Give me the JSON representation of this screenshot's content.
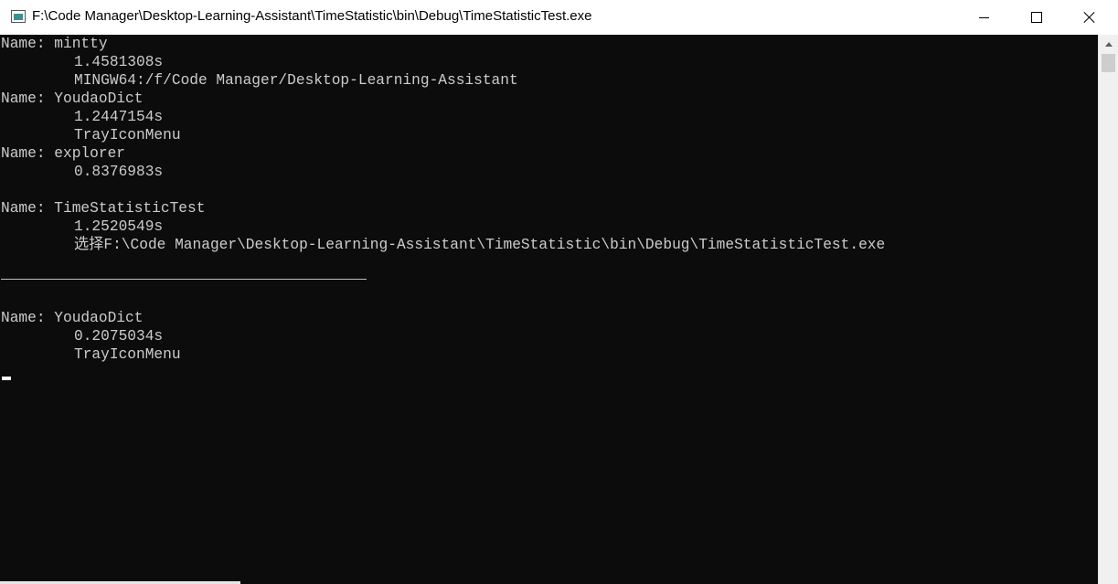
{
  "window": {
    "title": "F:\\Code Manager\\Desktop-Learning-Assistant\\TimeStatistic\\bin\\Debug\\TimeStatisticTest.exe",
    "icon": "console-app-icon",
    "controls": {
      "minimize": "minimize-icon",
      "maximize": "maximize-icon",
      "close": "close-icon"
    }
  },
  "console": {
    "lines": [
      "Name: mintty",
      "1.4581308s",
      "MINGW64:/f/Code Manager/Desktop-Learning-Assistant",
      "Name: YoudaoDict",
      "1.2447154s",
      "TrayIconMenu",
      "Name: explorer",
      "0.8376983s",
      "Name: TimeStatisticTest",
      "1.2520549s",
      "选择F:\\Code Manager\\Desktop-Learning-Assistant\\TimeStatistic\\bin\\Debug\\TimeStatisticTest.exe",
      "Name: YoudaoDict",
      "0.2075034s",
      "TrayIconMenu"
    ]
  },
  "colors": {
    "console_bg": "#0c0c0c",
    "console_text": "#cccccc",
    "titlebar_bg": "#ffffff"
  }
}
